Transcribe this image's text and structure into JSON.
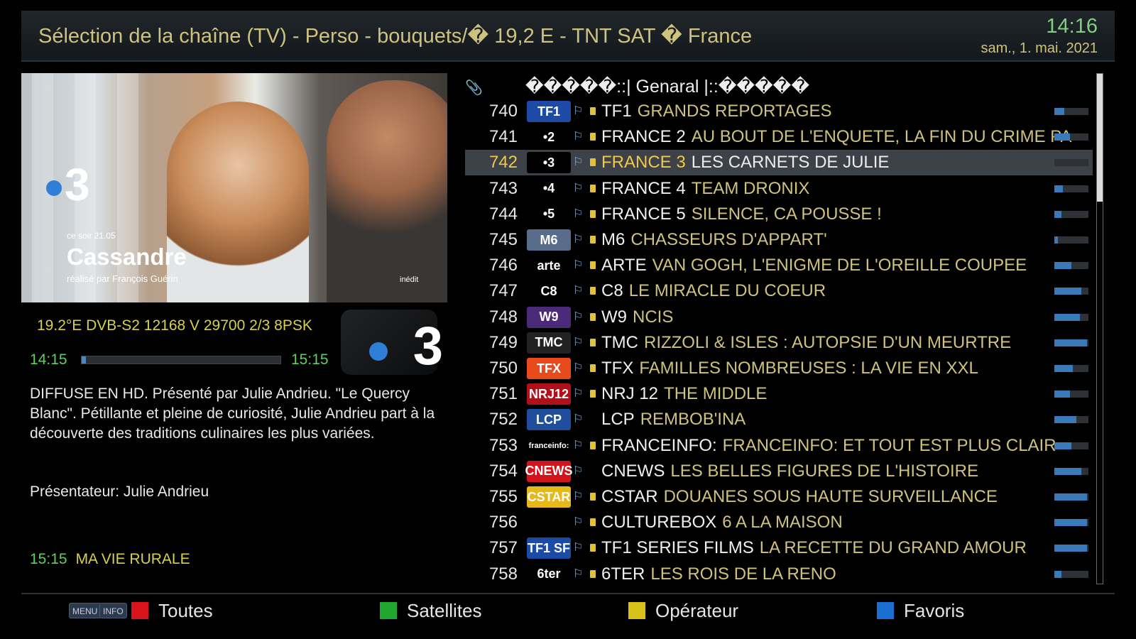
{
  "header": {
    "title": "Sélection de la chaîne (TV) - Perso - bouquets/� 19,2 E - TNT SAT  � France",
    "time": "14:16",
    "date": "sam.,  1. mai. 2021"
  },
  "preview": {
    "channel_logo_text": "3",
    "tonight": "ce soir 21.05",
    "show": "Cassandre",
    "director": "réalisé par François Guérin",
    "badge": "inédit"
  },
  "info": {
    "tuner": "19.2°E  DVB-S2  12168 V 29700 2/3 8PSK",
    "start": "14:15",
    "end": "15:15",
    "progress": 0.02,
    "logo_text": "3",
    "description": "DIFFUSE EN HD.  Présenté par Julie Andrieu. \"Le Quercy Blanc\". Pétillante et pleine de curiosité, Julie Andrieu part à la découverte des traditions culinaires les plus variées.",
    "presenter": "Présentateur: Julie Andrieu",
    "next_time": "15:15",
    "next_title": "MA VIE RURALE"
  },
  "list": {
    "header": "�����::| Genaral |::�����",
    "selected_index": 2,
    "channels": [
      {
        "num": "740",
        "logo": "TF1",
        "logo_color": "#1c4aa5",
        "name": "TF1",
        "program": "GRANDS REPORTAGES",
        "signal": 0.3,
        "locked": true
      },
      {
        "num": "741",
        "logo": "•2",
        "logo_color": "#000000",
        "name": "FRANCE 2",
        "program": "AU BOUT DE L'ENQUETE, LA FIN DU CRIME PA",
        "signal": 0.45,
        "locked": true
      },
      {
        "num": "742",
        "logo": "•3",
        "logo_color": "#000000",
        "name": "FRANCE 3",
        "program": "LES CARNETS DE JULIE",
        "signal": 0.0,
        "locked": true
      },
      {
        "num": "743",
        "logo": "•4",
        "logo_color": "#000000",
        "name": "FRANCE 4",
        "program": "TEAM DRONIX",
        "signal": 0.25,
        "locked": true
      },
      {
        "num": "744",
        "logo": "•5",
        "logo_color": "#000000",
        "name": "FRANCE 5",
        "program": "SILENCE, CA POUSSE !",
        "signal": 0.2,
        "locked": true
      },
      {
        "num": "745",
        "logo": "M6",
        "logo_color": "#5a6c8c",
        "name": "M6",
        "program": "CHASSEURS D'APPART'",
        "signal": 0.1,
        "locked": true
      },
      {
        "num": "746",
        "logo": "arte",
        "logo_color": "#000000",
        "name": "ARTE",
        "program": "VAN GOGH, L'ENIGME DE L'OREILLE COUPEE",
        "signal": 0.5,
        "locked": true
      },
      {
        "num": "747",
        "logo": "C8",
        "logo_color": "#000000",
        "name": "C8",
        "program": "LE MIRACLE DU COEUR",
        "signal": 0.8,
        "locked": true
      },
      {
        "num": "748",
        "logo": "W9",
        "logo_color": "#4b2a7a",
        "name": "W9",
        "program": "NCIS",
        "signal": 0.75,
        "locked": true
      },
      {
        "num": "749",
        "logo": "TMC",
        "logo_color": "#222222",
        "name": "TMC",
        "program": "RIZZOLI & ISLES : AUTOPSIE D'UN MEURTRE",
        "signal": 0.95,
        "locked": true
      },
      {
        "num": "750",
        "logo": "TFX",
        "logo_color": "#e84a1c",
        "name": "TFX",
        "program": "FAMILLES NOMBREUSES : LA VIE EN XXL",
        "signal": 0.55,
        "locked": true
      },
      {
        "num": "751",
        "logo": "NRJ12",
        "logo_color": "#b0101a",
        "name": "NRJ 12",
        "program": "THE MIDDLE",
        "signal": 0.45,
        "locked": true
      },
      {
        "num": "752",
        "logo": "LCP",
        "logo_color": "#1e4e9c",
        "name": "LCP",
        "program": "REMBOB'INA",
        "signal": 0.65,
        "locked": false
      },
      {
        "num": "753",
        "logo": "franceinfo:",
        "logo_color": "#000000",
        "name": "FRANCEINFO:",
        "program": "FRANCEINFO: ET TOUT EST PLUS CLAIR",
        "signal": 0.5,
        "locked": true
      },
      {
        "num": "754",
        "logo": "CNEWS",
        "logo_color": "#d4121c",
        "name": "CNEWS",
        "program": "LES BELLES FIGURES DE L'HISTOIRE",
        "signal": 0.8,
        "locked": false
      },
      {
        "num": "755",
        "logo": "CSTAR",
        "logo_color": "#e7b81a",
        "name": "CSTAR",
        "program": "DOUANES SOUS HAUTE SURVEILLANCE",
        "signal": 0.95,
        "locked": true
      },
      {
        "num": "756",
        "logo": "",
        "logo_color": "#000000",
        "name": "CULTUREBOX",
        "program": "6 A LA MAISON",
        "signal": 0.95,
        "locked": true
      },
      {
        "num": "757",
        "logo": "TF1 SF",
        "logo_color": "#1c4aa5",
        "name": "TF1 SERIES FILMS",
        "program": "LA RECETTE DU GRAND AMOUR",
        "signal": 0.95,
        "locked": true
      },
      {
        "num": "758",
        "logo": "6ter",
        "logo_color": "#000000",
        "name": "6TER",
        "program": "LES ROIS DE LA RENO",
        "signal": 0.2,
        "locked": true
      }
    ]
  },
  "footer": {
    "key_menu": "MENU",
    "key_info": "INFO",
    "red": {
      "label": "Toutes",
      "color": "#d9141c"
    },
    "green": {
      "label": "Satellites",
      "color": "#21a630"
    },
    "yellow": {
      "label": "Opérateur",
      "color": "#d8c21a"
    },
    "blue": {
      "label": "Favoris",
      "color": "#1b6fd0"
    }
  }
}
